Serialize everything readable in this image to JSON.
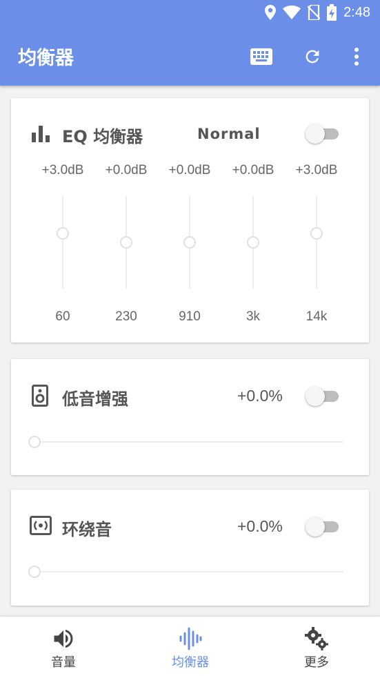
{
  "status_bar": {
    "time": "2:48"
  },
  "app_bar": {
    "title": "均衡器",
    "actions": [
      "keyboard-icon",
      "refresh-icon",
      "more-vert-icon"
    ]
  },
  "eq_card": {
    "title": "EQ 均衡器",
    "preset": "Normal",
    "enabled": false,
    "bands": [
      {
        "gain": "+3.0dB",
        "freq": "60",
        "level": 0.6
      },
      {
        "gain": "+0.0dB",
        "freq": "230",
        "level": 0.5
      },
      {
        "gain": "+0.0dB",
        "freq": "910",
        "level": 0.5
      },
      {
        "gain": "+0.0dB",
        "freq": "3k",
        "level": 0.5
      },
      {
        "gain": "+3.0dB",
        "freq": "14k",
        "level": 0.6
      }
    ]
  },
  "bass_card": {
    "title": "低音增强",
    "value": "+0.0%",
    "enabled": false,
    "level": 0.0
  },
  "surround_card": {
    "title": "环绕音",
    "value": "+0.0%",
    "enabled": false,
    "level": 0.0
  },
  "bottom_nav": {
    "items": [
      {
        "label": "音量",
        "icon": "volume-icon",
        "active": false
      },
      {
        "label": "均衡器",
        "icon": "equalizer-icon",
        "active": true
      },
      {
        "label": "更多",
        "icon": "settings-icon",
        "active": false
      }
    ]
  },
  "colors": {
    "primary": "#6b8fe8",
    "card_bg": "#ffffff",
    "page_bg": "#f2f2f2",
    "switch_off": "#bdbdbd"
  }
}
